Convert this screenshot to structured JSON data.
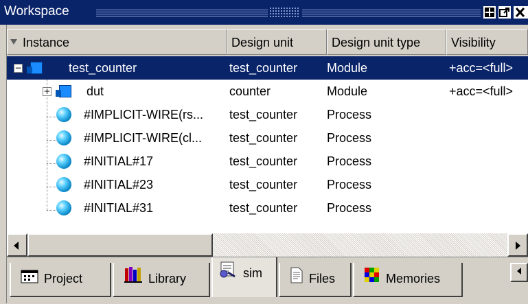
{
  "window": {
    "title": "Workspace",
    "accent": "#0a246a"
  },
  "columns": [
    "Instance",
    "Design unit",
    "Design unit type",
    "Visibility"
  ],
  "rows": [
    {
      "instance": "test_counter",
      "unit": "test_counter",
      "type": "Module",
      "visibility": "+acc=<full>",
      "icon": "module-icon",
      "selected": true
    },
    {
      "instance": "dut",
      "unit": "counter",
      "type": "Module",
      "visibility": "+acc=<full>",
      "icon": "module-icon"
    },
    {
      "instance": "#IMPLICIT-WIRE(rs...",
      "unit": "test_counter",
      "type": "Process",
      "visibility": "",
      "icon": "process-icon"
    },
    {
      "instance": "#IMPLICIT-WIRE(cl...",
      "unit": "test_counter",
      "type": "Process",
      "visibility": "",
      "icon": "process-icon"
    },
    {
      "instance": "#INITIAL#17",
      "unit": "test_counter",
      "type": "Process",
      "visibility": "",
      "icon": "process-icon"
    },
    {
      "instance": "#INITIAL#23",
      "unit": "test_counter",
      "type": "Process",
      "visibility": "",
      "icon": "process-icon"
    },
    {
      "instance": "#INITIAL#31",
      "unit": "test_counter",
      "type": "Process",
      "visibility": "",
      "icon": "process-icon"
    }
  ],
  "tabs": [
    {
      "label": "Project",
      "icon": "project-icon"
    },
    {
      "label": "Library",
      "icon": "library-icon"
    },
    {
      "label": "sim",
      "icon": "sim-icon",
      "active": true
    },
    {
      "label": "Files",
      "icon": "files-icon"
    },
    {
      "label": "Memories",
      "icon": "memories-icon"
    }
  ]
}
